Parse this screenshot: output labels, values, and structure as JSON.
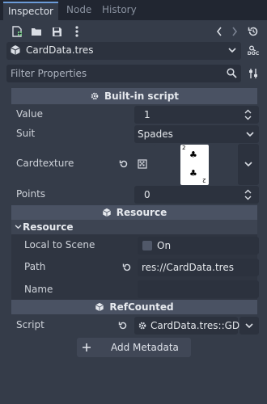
{
  "tabs": [
    "Inspector",
    "Node",
    "History"
  ],
  "toolbar": {
    "new_icon": "new-resource-icon",
    "open_icon": "folder-open-icon",
    "save_icon": "save-icon",
    "menu_icon": "vertical-dots-icon",
    "back_icon": "chevron-left-icon",
    "forward_icon": "chevron-right-icon",
    "history_icon": "history-icon"
  },
  "resource": {
    "name": "CardData.tres",
    "doc_label": "DOC"
  },
  "filter": {
    "placeholder": "Filter Properties"
  },
  "sections": {
    "builtin": "Built-in script",
    "resource": "Resource",
    "refcounted": "RefCounted"
  },
  "props": {
    "value_label": "Value",
    "value": "1",
    "suit_label": "Suit",
    "suit": "Spades",
    "cardtexture_label": "Cardtexture",
    "points_label": "Points",
    "points": "0"
  },
  "resource_group": {
    "title": "Resource",
    "local_label": "Local to Scene",
    "local_value": "On",
    "path_label": "Path",
    "path_value": "res://CardData.tres",
    "name_label": "Name",
    "name_value": ""
  },
  "script": {
    "label": "Script",
    "value": "CardData.tres::GDSc"
  },
  "add_metadata": "Add Metadata",
  "card_face": {
    "top_rank": "2",
    "bottom_rank": "2",
    "pip": "♣"
  },
  "colors": {
    "accent": "#6b9bd8",
    "panel": "#353c49",
    "header": "#4a5263"
  }
}
